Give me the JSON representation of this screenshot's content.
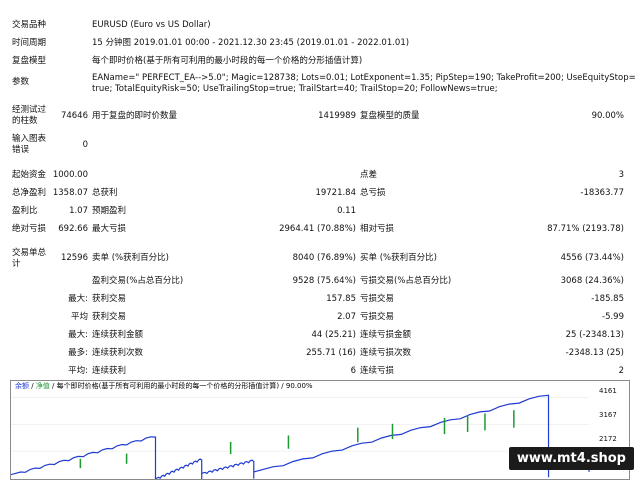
{
  "report": {
    "symbol_label": "交易品种",
    "symbol_value": "EURUSD (Euro vs US Dollar)",
    "period_label": "时间周期",
    "period_value": "15 分钟图 2019.01.01 00:00 - 2021.12.30 23:45 (2019.01.01 - 2022.01.01)",
    "model_label": "复盘模型",
    "model_value": "每个即时价格(基于所有可利用的最小时段的每一个价格的分形插值计算)",
    "params_label": "参数",
    "params_value": "EAName=\" PERFECT_EA-->5.0\"; Magic=128738; Lots=0.01; LotExponent=1.35; PipStep=190; TakeProfit=200; UseEquityStop=true; TotalEquityRisk=50; UseTrailingStop=true; TrailStart=40; TrailStop=20; FollowNews=true;",
    "bars_label": "经测试过的柱数",
    "bars_value": "74646",
    "ticks_label": "用于复盘的即时价数量",
    "ticks_value": "1419989",
    "quality_label": "复盘模型的质量",
    "quality_value": "90.00%",
    "errors_label": "输入图表错误",
    "errors_value": "0"
  },
  "stats": {
    "deposit_label": "起始资金",
    "deposit_value": "1000.00",
    "spread_label": "点差",
    "spread_value": "3",
    "net_label": "总净盈利",
    "net_value": "1358.07",
    "gross_profit_label": "总获利",
    "gross_profit_value": "19721.84",
    "gross_loss_label": "总亏损",
    "gross_loss_value": "-18363.77",
    "pf_label": "盈利比",
    "pf_value": "1.07",
    "expected_label": "预期盈利",
    "expected_value": "0.11",
    "abs_dd_label": "绝对亏损",
    "abs_dd_value": "692.66",
    "max_dd_label": "最大亏损",
    "max_dd_value": "2964.41 (70.88%)",
    "rel_dd_label": "相对亏损",
    "rel_dd_value": "87.71% (2193.78)",
    "trades_label": "交易单总计",
    "trades_value": "12596",
    "short_label": "卖单 (%获利百分比)",
    "short_value": "8040 (76.89%)",
    "long_label": "买单 (%获利百分比)",
    "long_value": "4556 (73.44%)",
    "win_label": "盈利交易(%占总百分比)",
    "win_value": "9528 (75.64%)",
    "loss_label": "亏损交易(%占总百分比)",
    "loss_value": "3068 (24.36%)",
    "max_prefix": "最大:",
    "avg_prefix": "平均",
    "largest_win_label": "获利交易",
    "largest_win_value": "157.85",
    "largest_loss_label": "亏损交易",
    "largest_loss_value": "-185.85",
    "avg_win_label": "获利交易",
    "avg_win_value": "2.07",
    "avg_loss_label": "亏损交易",
    "avg_loss_value": "-5.99",
    "max_prefix2": "最大:",
    "max_cons_win_label": "连续获利金额",
    "max_cons_win_value": "44 (25.21)",
    "max_cons_loss_label": "连续亏损金额",
    "max_cons_loss_value": "25 (-2348.13)",
    "most_prefix": "最多:",
    "most_cons_win_label": "连续获利次数",
    "most_cons_win_value": "255.71 (16)",
    "most_cons_loss_label": "连续亏损次数",
    "most_cons_loss_value": "-2348.13 (25)",
    "avg_prefix2": "平均:",
    "avg_cons_win_label": "连续获利",
    "avg_cons_win_value": "6",
    "avg_cons_loss_label": "连续亏损",
    "avg_cons_loss_value": "2"
  },
  "chart_header": {
    "balance": "余额",
    "sep1": " / ",
    "equity": "净值",
    "rest": " / 每个即时价格(基于所有可利用的最小时段的每一个价格的分形插值计算) / 90.00%"
  },
  "chart_data": {
    "type": "line",
    "y_ticks": [
      "4161",
      "3167",
      "2172"
    ],
    "ylim": [
      1100,
      4400
    ],
    "series": [],
    "colors": {
      "balance": "#1f3bd0",
      "equity": "#1c9a32"
    }
  },
  "watermark": "www.mt4.shop"
}
